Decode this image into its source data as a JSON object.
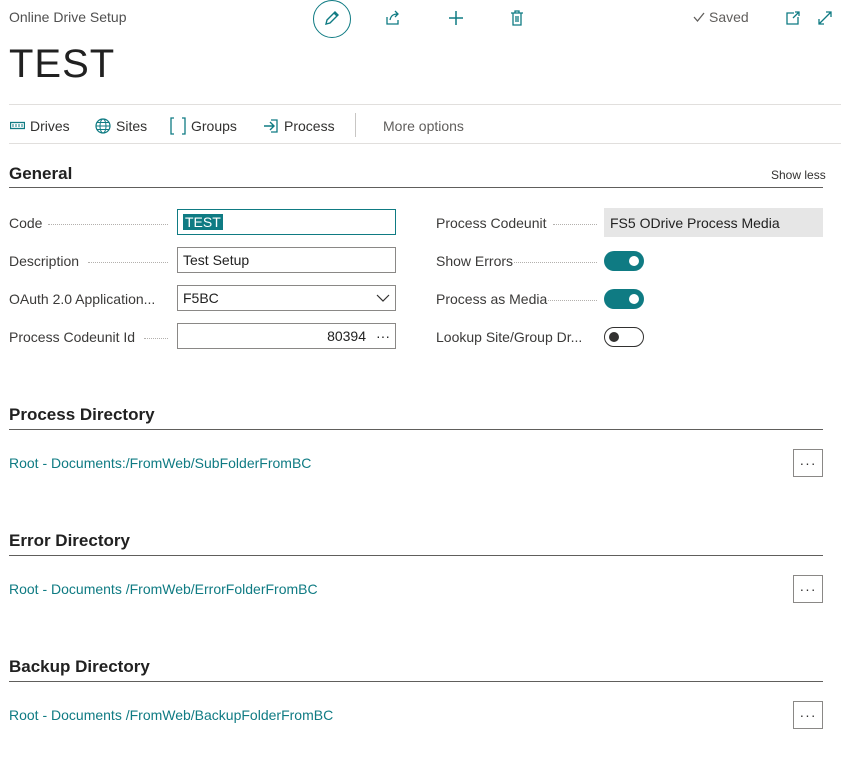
{
  "header": {
    "caption": "Online Drive Setup",
    "title": "TEST",
    "saved_label": "Saved"
  },
  "actions": {
    "drives": "Drives",
    "sites": "Sites",
    "groups": "Groups",
    "process": "Process",
    "more": "More options"
  },
  "general": {
    "title": "General",
    "show_less": "Show less",
    "code_label": "Code",
    "code_value": "TEST",
    "description_label": "Description",
    "description_value": "Test Setup",
    "oauth_label": "OAuth 2.0 Application...",
    "oauth_value": "F5BC",
    "codeunit_id_label": "Process Codeunit Id",
    "codeunit_id_value": "80394",
    "codeunit_label": "Process Codeunit",
    "codeunit_value": "FS5 ODrive Process Media",
    "show_errors_label": "Show Errors",
    "show_errors_on": true,
    "process_media_label": "Process as Media",
    "process_media_on": true,
    "lookup_label": "Lookup Site/Group Dr...",
    "lookup_on": false
  },
  "process_dir": {
    "title": "Process Directory",
    "path": "Root - Documents:/FromWeb/SubFolderFromBC"
  },
  "error_dir": {
    "title": "Error Directory",
    "path": "Root - Documents /FromWeb/ErrorFolderFromBC"
  },
  "backup_dir": {
    "title": "Backup Directory",
    "path": "Root - Documents /FromWeb/BackupFolderFromBC"
  },
  "ellipsis": "···",
  "colors": {
    "accent": "#0f7b83",
    "link": "#0f7b83"
  },
  "icons": [
    "edit-icon",
    "share-icon",
    "add-icon",
    "delete-icon",
    "check-icon",
    "open-new-window-icon",
    "expand-icon",
    "drives-icon",
    "globe-icon",
    "groups-icon",
    "process-icon",
    "chevron-down-icon"
  ]
}
